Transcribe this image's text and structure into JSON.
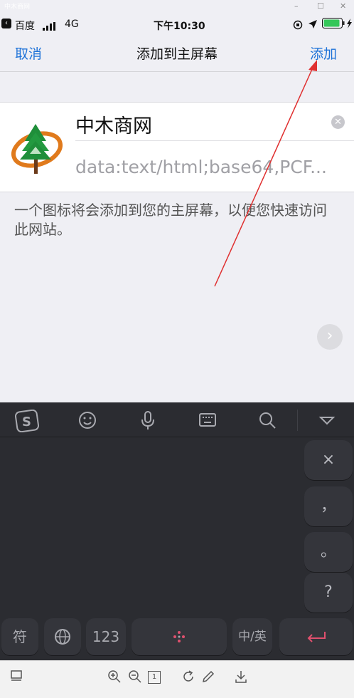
{
  "window": {
    "title": "中木商网",
    "controls": [
      "–",
      "☐",
      "✕"
    ]
  },
  "status": {
    "back_app": "百度",
    "network": "4G",
    "time": "下午10:30"
  },
  "nav": {
    "cancel": "取消",
    "title": "添加到主屏幕",
    "add": "添加"
  },
  "shortcut": {
    "name": "中木商网",
    "url": "data:text/html;base64,PCF..."
  },
  "description": "一个图标将会添加到您的主屏幕，以便您快速访问此网站。",
  "keyboard": {
    "toolbar_icons": [
      "sogou-logo-icon",
      "emoji-icon",
      "microphone-icon",
      "keyboard-icon",
      "search-icon",
      "collapse-icon"
    ],
    "right_keys": [
      "×",
      "，",
      "。",
      "?"
    ],
    "bottom_keys": {
      "symbol": "符",
      "numbers": "123",
      "lang": "中/英"
    }
  },
  "bottom_toolbar": {
    "page_number": "1"
  },
  "colors": {
    "accent": "#1f73d8",
    "annotation": "#e03030",
    "keyboard_bg": "#2b2c31"
  }
}
